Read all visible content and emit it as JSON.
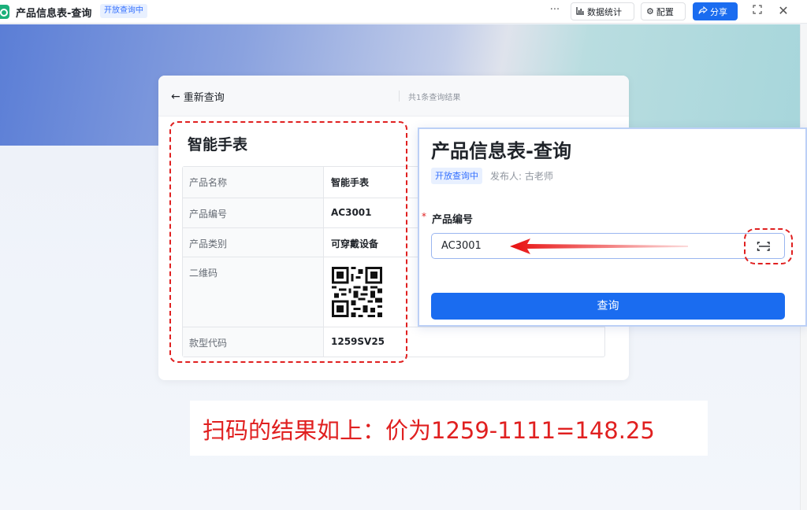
{
  "window": {
    "title": "产品信息表-查询",
    "status_tag": "开放查询中",
    "more_label": "···",
    "buttons": {
      "stats": "数据统计",
      "config": "配置",
      "share": "分享"
    }
  },
  "result_card": {
    "back_label": "重新查询",
    "result_count": "共1条查询结果",
    "product_title": "智能手表",
    "rows": [
      {
        "label": "产品名称",
        "value": "智能手表"
      },
      {
        "label": "产品编号",
        "value": "AC3001"
      },
      {
        "label": "产品类别",
        "value": "可穿戴设备"
      },
      {
        "label": "二维码",
        "value": ""
      },
      {
        "label": "款型代码",
        "value": "1259SV25"
      }
    ]
  },
  "query_form": {
    "title": "产品信息表-查询",
    "status_tag": "开放查询中",
    "publisher": "发布人: 古老师",
    "field_required_mark": "*",
    "field_label": "产品编号",
    "field_value": "AC3001",
    "submit_label": "查询"
  },
  "annotation": {
    "caption": "扫码的结果如上：价为1259-1111=148.25"
  },
  "colors": {
    "accent": "#1a6cf0",
    "annotation_red": "#e02020",
    "tag_bg": "#e8f0ff"
  }
}
